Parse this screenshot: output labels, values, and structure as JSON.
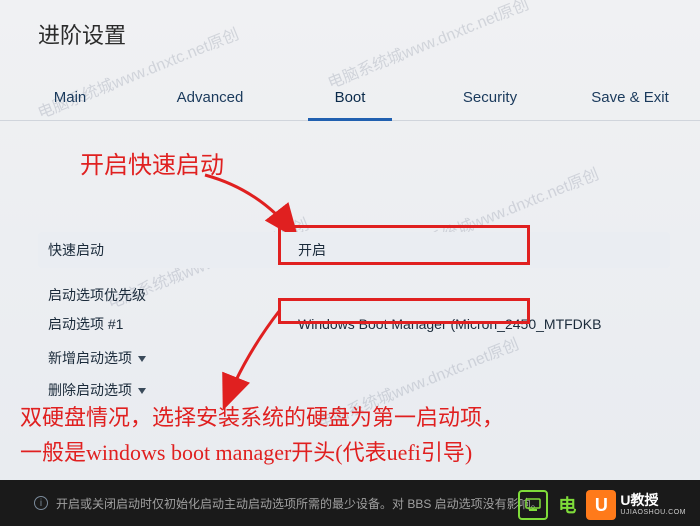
{
  "title": "进阶设置",
  "tabs": {
    "main": "Main",
    "advanced": "Advanced",
    "boot": "Boot",
    "security": "Security",
    "save_exit": "Save & Exit"
  },
  "annotation1": "开启快速启动",
  "rows": {
    "fast_boot_label": "快速启动",
    "fast_boot_value": "开启",
    "priority_label": "启动选项优先级",
    "option1_label": "启动选项 #1",
    "option1_value": "Windows Boot Manager (Micron_2450_MTFDKB",
    "add_label": "新增启动选项",
    "del_label": "删除启动选项"
  },
  "annotation2_line1": "双硬盘情况，选择安装系统的硬盘为第一启动项，",
  "annotation2_line2": "一般是windows boot manager开头(代表uefi引导)",
  "footer_text": "开启或关闭启动时仅初始化启动主动启动选项所需的最少设备。对 BBS 启动选项没有影响。",
  "watermark": "电脑系统城www.dnxtc.net原创",
  "logo_dn": "电",
  "logo_u_letter": "U",
  "logo_u_cn": "U教授",
  "logo_u_en": "UJIAOSHOU.COM"
}
